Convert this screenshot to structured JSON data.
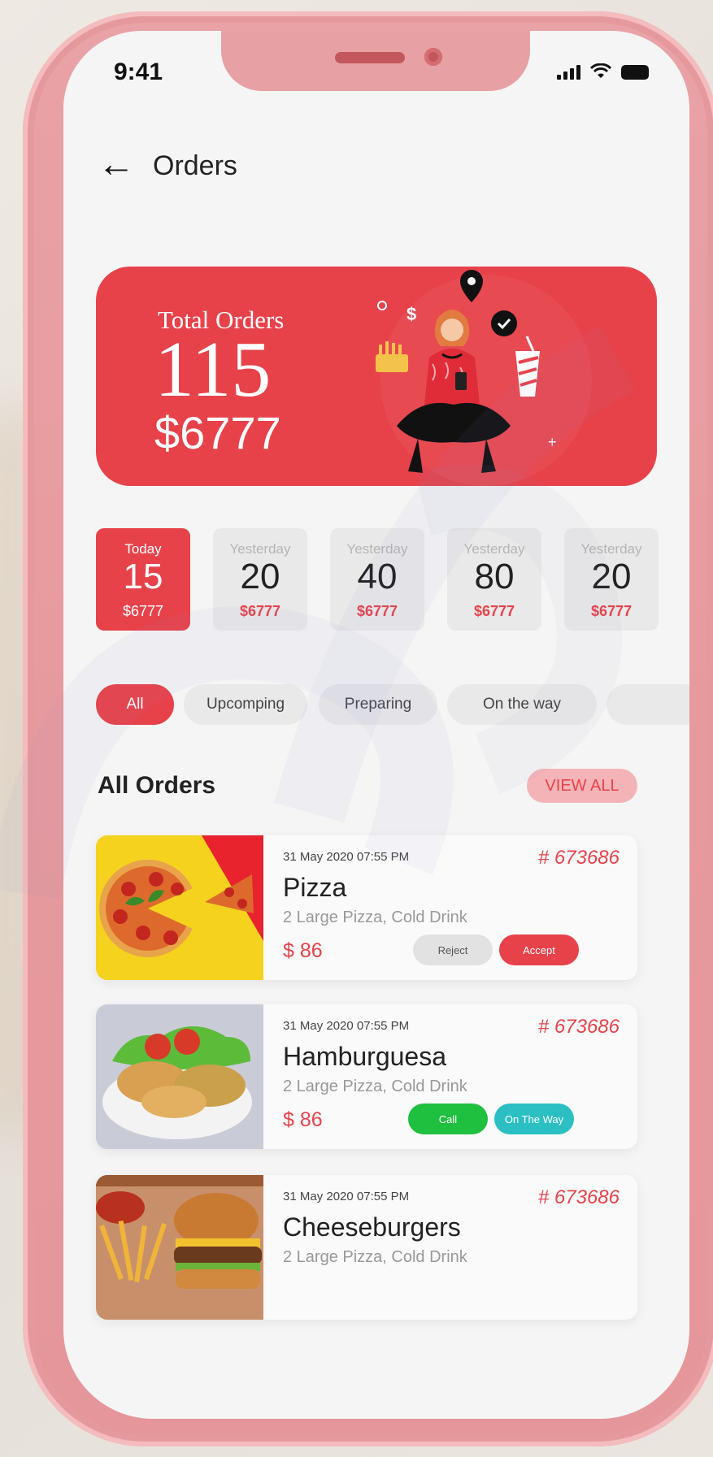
{
  "status_bar": {
    "time": "9:41"
  },
  "header": {
    "title": "Orders"
  },
  "total_card": {
    "label": "Total Orders",
    "count": "115",
    "amount": "$6777"
  },
  "day_stats": [
    {
      "label": "Today",
      "count": "15",
      "amount": "$6777",
      "active": true
    },
    {
      "label": "Yesterday",
      "count": "20",
      "amount": "$6777",
      "active": false
    },
    {
      "label": "Yesterday",
      "count": "40",
      "amount": "$6777",
      "active": false
    },
    {
      "label": "Yesterday",
      "count": "80",
      "amount": "$6777",
      "active": false
    },
    {
      "label": "Yesterday",
      "count": "20",
      "amount": "$6777",
      "active": false
    }
  ],
  "filters": [
    {
      "label": "All",
      "active": true
    },
    {
      "label": "Upcomping",
      "active": false
    },
    {
      "label": "Preparing",
      "active": false
    },
    {
      "label": "On the way",
      "active": false
    },
    {
      "label": "",
      "active": false
    }
  ],
  "section": {
    "title": "All Orders",
    "view_all": "VIEW ALL"
  },
  "orders": [
    {
      "date": "31 May 2020 07:55 PM",
      "id": "# 673686",
      "name": "Pizza",
      "desc": "2 Large Pizza, Cold Drink",
      "price": "$ 86",
      "actions": [
        "Reject",
        "Accept"
      ]
    },
    {
      "date": "31 May 2020 07:55 PM",
      "id": "# 673686",
      "name": "Hamburguesa",
      "desc": "2 Large Pizza, Cold Drink",
      "price": "$ 86",
      "actions": [
        "Call",
        "On The Way"
      ]
    },
    {
      "date": "31 May 2020 07:55 PM",
      "id": "# 673686",
      "name": "Cheeseburgers",
      "desc": "2 Large Pizza, Cold Drink",
      "price": "",
      "actions": []
    }
  ],
  "colors": {
    "accent": "#e7424a",
    "frame": "#e79a9e",
    "call": "#1fbf3f",
    "on_the_way": "#2bbfc3"
  }
}
